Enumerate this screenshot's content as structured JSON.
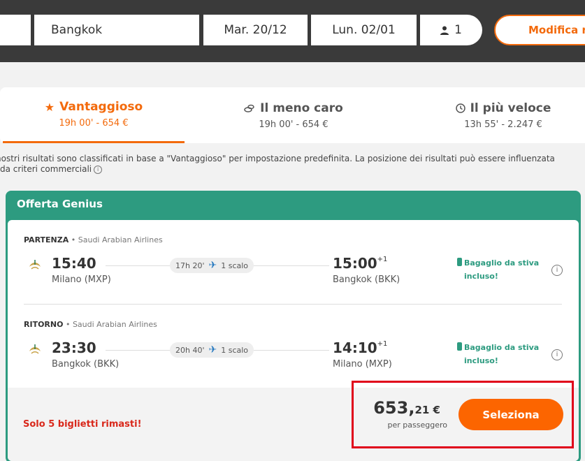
{
  "search": {
    "destination": "Bangkok",
    "departure_date": "Mar. 20/12",
    "return_date": "Lun. 02/01",
    "passengers": "1",
    "modify_label": "Modifica ric"
  },
  "tabs": [
    {
      "label": "Vantaggioso",
      "sub": "19h 00' - 654 €",
      "icon": "star-icon",
      "active": true
    },
    {
      "label": "Il meno caro",
      "sub": "19h 00' - 654 €",
      "icon": "coins-icon",
      "active": false
    },
    {
      "label": "Il più veloce",
      "sub": "13h 55' - 2.247 €",
      "icon": "clock-icon",
      "active": false
    }
  ],
  "disclaimer": "nostri risultati sono classificati in base a \"Vantaggioso\" per impostazione predefinita. La posizione dei risultati può essere influenzata da criteri commerciali",
  "offer": {
    "title": "Offerta Genius",
    "legs": [
      {
        "label": "PARTENZA",
        "airline": "• Saudi Arabian Airlines",
        "dep_time": "15:40",
        "dep_city": "Milano (MXP)",
        "duration": "17h 20'",
        "stops": "1 scalo",
        "arr_time": "15:00",
        "arr_day_offset": "+1",
        "arr_city": "Bangkok (BKK)",
        "baggage_line1": "Bagaglio da stiva",
        "baggage_line2": "incluso!"
      },
      {
        "label": "RITORNO",
        "airline": "• Saudi Arabian Airlines",
        "dep_time": "23:30",
        "dep_city": "Bangkok (BKK)",
        "duration": "20h 40'",
        "stops": "1 scalo",
        "arr_time": "14:10",
        "arr_day_offset": "+1",
        "arr_city": "Milano (MXP)",
        "baggage_line1": "Bagaglio da stiva",
        "baggage_line2": "incluso!"
      }
    ],
    "urgency": "Solo 5 biglietti rimasti!",
    "price_int": "653,",
    "price_dec": "21 €",
    "price_sub": "per passeggero",
    "select_label": "Seleziona"
  },
  "colors": {
    "accent": "#f36a0c",
    "genius": "#2d9b80",
    "urgency": "#d9281b",
    "highlight": "#e0001a"
  }
}
